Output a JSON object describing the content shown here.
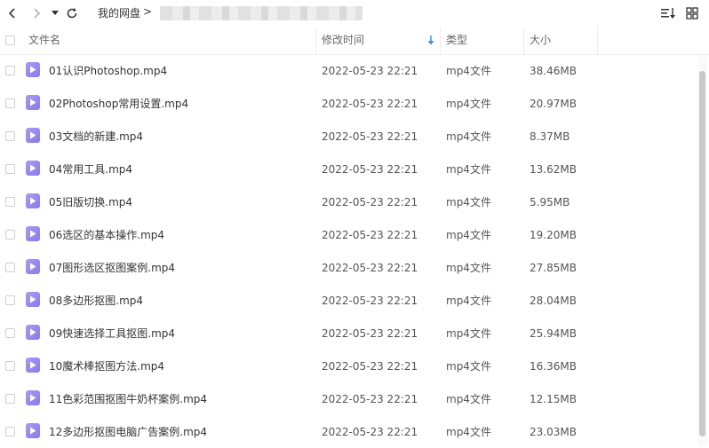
{
  "toolbar": {
    "breadcrumb_root": "我的网盘",
    "breadcrumb_separator": ">",
    "back_icon": "chevron-left-icon",
    "forward_icon": "chevron-right-icon",
    "history_icon": "caret-down-icon",
    "refresh_icon": "refresh-icon",
    "sort_icon": "sort-list-icon",
    "grid_icon": "grid-view-icon"
  },
  "header": {
    "name": "文件名",
    "modified": "修改时间",
    "type": "类型",
    "size": "大小"
  },
  "files": [
    {
      "name": "01认识Photoshop.mp4",
      "modified": "2022-05-23 22:21",
      "type": "mp4文件",
      "size": "38.46MB"
    },
    {
      "name": "02Photoshop常用设置.mp4",
      "modified": "2022-05-23 22:21",
      "type": "mp4文件",
      "size": "20.97MB"
    },
    {
      "name": "03文档的新建.mp4",
      "modified": "2022-05-23 22:21",
      "type": "mp4文件",
      "size": "8.37MB"
    },
    {
      "name": "04常用工具.mp4",
      "modified": "2022-05-23 22:21",
      "type": "mp4文件",
      "size": "13.62MB"
    },
    {
      "name": "05旧版切换.mp4",
      "modified": "2022-05-23 22:21",
      "type": "mp4文件",
      "size": "5.95MB"
    },
    {
      "name": "06选区的基本操作.mp4",
      "modified": "2022-05-23 22:21",
      "type": "mp4文件",
      "size": "19.20MB"
    },
    {
      "name": "07图形选区抠图案例.mp4",
      "modified": "2022-05-23 22:21",
      "type": "mp4文件",
      "size": "27.85MB"
    },
    {
      "name": "08多边形抠图.mp4",
      "modified": "2022-05-23 22:21",
      "type": "mp4文件",
      "size": "28.04MB"
    },
    {
      "name": "09快速选择工具抠图.mp4",
      "modified": "2022-05-23 22:21",
      "type": "mp4文件",
      "size": "25.94MB"
    },
    {
      "name": "10魔术棒抠图方法.mp4",
      "modified": "2022-05-23 22:21",
      "type": "mp4文件",
      "size": "16.36MB"
    },
    {
      "name": "11色彩范围抠图牛奶杯案例.mp4",
      "modified": "2022-05-23 22:21",
      "type": "mp4文件",
      "size": "12.15MB"
    },
    {
      "name": "12多边形抠图电脑广告案例.mp4",
      "modified": "2022-05-23 22:21",
      "type": "mp4文件",
      "size": "23.03MB"
    }
  ],
  "colors": {
    "file_icon": "#9584ef",
    "sort_arrow": "#3a8ee6"
  }
}
